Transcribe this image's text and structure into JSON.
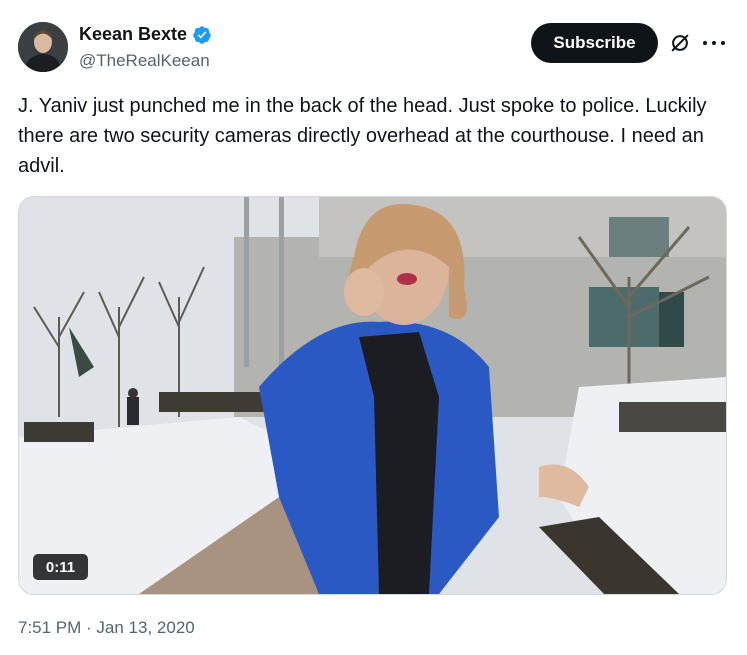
{
  "author": {
    "display_name": "Keean Bexte",
    "handle": "@TheRealKeean",
    "verified_icon": "verified-badge-icon",
    "verified_color": "#1d9bf0"
  },
  "actions": {
    "subscribe_label": "Subscribe",
    "grok_icon": "grok-slash-icon",
    "more_icon": "more-options-icon"
  },
  "tweet": {
    "text": "J. Yaniv just punched me in the back of the head. Just spoke to police. Luckily there are two security cameras directly overhead at the courthouse. I need an advil."
  },
  "media": {
    "type": "video",
    "duration": "0:11"
  },
  "meta": {
    "timestamp": "7:51 PM · Jan 13, 2020"
  },
  "colors": {
    "text": "#0f1419",
    "secondary": "#536471",
    "button_bg": "#0f1419"
  }
}
